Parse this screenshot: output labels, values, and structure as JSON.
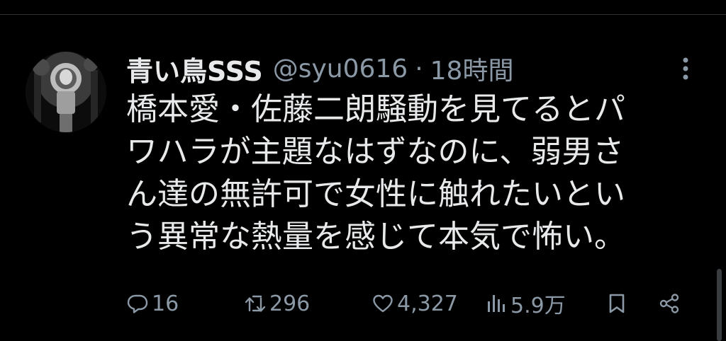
{
  "tweet": {
    "author": {
      "display_name": "青い鳥SSS",
      "handle": "@syu0616",
      "separator": "·",
      "time": "18時間"
    },
    "text_lines": [
      "橋本愛・佐藤二朗騒動を見てるとパ",
      "ワハラが主題なはずなのに、弱男さ",
      "ん達の無許可で女性に触れたいとい",
      "う異常な熱量を感じて本気で怖い。"
    ],
    "actions": {
      "reply_count": "16",
      "retweet_count": "296",
      "like_count": "4,327",
      "view_count": "5.9万"
    }
  },
  "colors": {
    "background": "#000000",
    "text_primary": "#e7e9ea",
    "text_secondary": "#8b98a5",
    "divider": "#2f3336"
  },
  "icons": {
    "more": "more-dots-icon",
    "reply": "speech-bubble-icon",
    "retweet": "retweet-arrows-icon",
    "like": "heart-icon",
    "views": "bar-chart-icon",
    "bookmark": "bookmark-icon",
    "share": "share-nodes-icon"
  }
}
